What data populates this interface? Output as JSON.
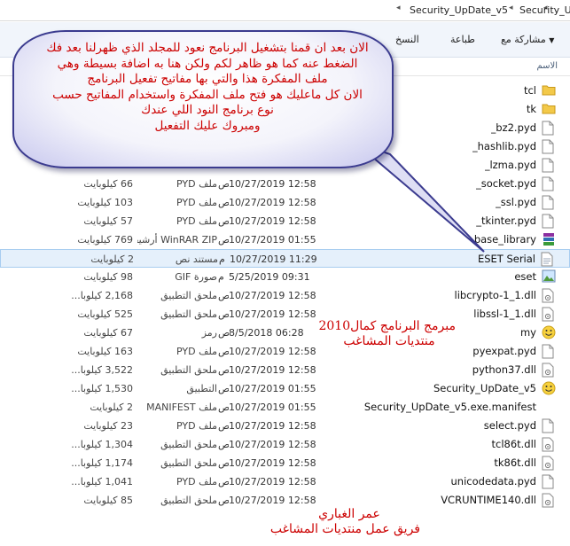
{
  "breadcrumb": {
    "items": [
      "Security_UpDate_v5",
      "Security_Up"
    ]
  },
  "toolbar": {
    "share": "مشاركة مع",
    "print": "طباعة",
    "copy": "النسخ"
  },
  "columns": {
    "name": "الاسم"
  },
  "rows": [
    {
      "name": "tcl",
      "icon": "folder-icon",
      "date": "",
      "type": "",
      "size": ""
    },
    {
      "name": "tk",
      "icon": "folder-icon",
      "date": "",
      "type": "",
      "size": ""
    },
    {
      "name": "_bz2.pyd",
      "icon": "file-icon",
      "date": "",
      "type": "",
      "size": ""
    },
    {
      "name": "_hashlib.pyd",
      "icon": "file-icon",
      "date": "",
      "type": "",
      "size": ""
    },
    {
      "name": "_lzma.pyd",
      "icon": "file-icon",
      "date": "",
      "type": "",
      "size": ""
    },
    {
      "name": "_socket.pyd",
      "icon": "file-icon",
      "date": "10/27/2019 12:58",
      "ampm": "ص",
      "type": "ملف PYD",
      "size": "66 كيلوبايت"
    },
    {
      "name": "_ssl.pyd",
      "icon": "file-icon",
      "date": "10/27/2019 12:58",
      "ampm": "ص",
      "type": "ملف PYD",
      "size": "103 كيلوبايت"
    },
    {
      "name": "_tkinter.pyd",
      "icon": "file-icon",
      "date": "10/27/2019 12:58",
      "ampm": "ص",
      "type": "ملف PYD",
      "size": "57 كيلوبايت"
    },
    {
      "name": "base_library",
      "icon": "winrar-icon",
      "date": "10/27/2019 01:55",
      "ampm": "ص",
      "type": "WinRAR ZIP أرشيف",
      "size": "769 كيلوبايت"
    },
    {
      "name": "ESET Serial",
      "icon": "text-file-icon",
      "date": "10/27/2019 11:29",
      "ampm": "م",
      "type": "مستند نص",
      "size": "2 كيلوبايت",
      "selected": true
    },
    {
      "name": "eset",
      "icon": "image-file-icon",
      "date": "5/25/2019 09:31",
      "ampm": "م",
      "type": "صورة GIF",
      "size": "98 كيلوبايت"
    },
    {
      "name": "libcrypto-1_1.dll",
      "icon": "dll-icon",
      "date": "10/27/2019 12:58",
      "ampm": "ص",
      "type": "ملحق التطبيق",
      "size": "2,168 كيلوبا..."
    },
    {
      "name": "libssl-1_1.dll",
      "icon": "dll-icon",
      "date": "10/27/2019 12:58",
      "ampm": "ص",
      "type": "ملحق التطبيق",
      "size": "525 كيلوبايت"
    },
    {
      "name": "my",
      "icon": "smiley-icon",
      "date": "8/5/2018 06:28",
      "ampm": "ص",
      "type": "رمز",
      "size": "67 كيلوبايت"
    },
    {
      "name": "pyexpat.pyd",
      "icon": "file-icon",
      "date": "10/27/2019 12:58",
      "ampm": "ص",
      "type": "ملف PYD",
      "size": "163 كيلوبايت"
    },
    {
      "name": "python37.dll",
      "icon": "dll-icon",
      "date": "10/27/2019 12:58",
      "ampm": "ص",
      "type": "ملحق التطبيق",
      "size": "3,522 كيلوبا..."
    },
    {
      "name": "Security_UpDate_v5",
      "icon": "smiley-icon",
      "date": "10/27/2019 01:55",
      "ampm": "ص",
      "type": "التطبيق",
      "size": "1,530 كيلوبا..."
    },
    {
      "name": "Security_UpDate_v5.exe.manifest",
      "icon": "",
      "date": "10/27/2019 01:55",
      "ampm": "ص",
      "type": "ملف MANIFEST",
      "size": "2 كيلوبايت"
    },
    {
      "name": "select.pyd",
      "icon": "file-icon",
      "date": "10/27/2019 12:58",
      "ampm": "ص",
      "type": "ملف PYD",
      "size": "23 كيلوبايت"
    },
    {
      "name": "tcl86t.dll",
      "icon": "dll-icon",
      "date": "10/27/2019 12:58",
      "ampm": "ص",
      "type": "ملحق التطبيق",
      "size": "1,304 كيلوبا..."
    },
    {
      "name": "tk86t.dll",
      "icon": "dll-icon",
      "date": "10/27/2019 12:58",
      "ampm": "ص",
      "type": "ملحق التطبيق",
      "size": "1,174 كيلوبا..."
    },
    {
      "name": "unicodedata.pyd",
      "icon": "file-icon",
      "date": "10/27/2019 12:58",
      "ampm": "ص",
      "type": "ملف PYD",
      "size": "1,041 كيلوبا..."
    },
    {
      "name": "VCRUNTIME140.dll",
      "icon": "dll-icon",
      "date": "10/27/2019 12:58",
      "ampm": "ص",
      "type": "ملحق التطبيق",
      "size": "85 كيلوبايت"
    }
  ],
  "balloon": {
    "lines": [
      "الان بعد ان قمنا بتشغيل البرنامج نعود للمجلد الذي ظهرلنا بعد فك",
      "الضغط عنه  كما هو ظاهر لكم ولكن هنا به اضافة بسيطة وهي",
      "ملف المفكرة هذا والتي بها مفاتيح تفعيل البرنامج",
      "الان كل ماعليك هو فتح ملف المفكرة واستخدام المفاتيح حسب",
      "نوع برنامج النود اللي عندك",
      "ومبروك عليك التفعيل"
    ]
  },
  "note1": {
    "line1": "مبرمج البرنامج كمال2010",
    "line2": "منتديات المشاغب"
  },
  "note2": {
    "line1": "عمر الغباري",
    "line2": "فريق عمل منتديات المشاغب"
  },
  "colors": {
    "accent": "#cc0000",
    "balloon_border": "#3b3b8f",
    "selection": "#e5f0fb"
  }
}
